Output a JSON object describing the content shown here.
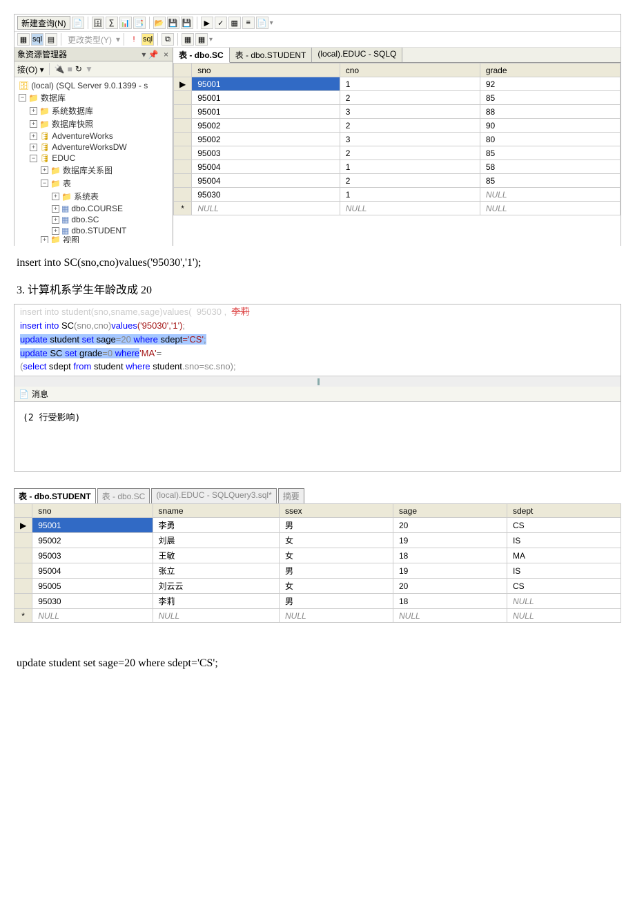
{
  "toolbar": {
    "newQuery": "新建查询(N)",
    "changeType": "更改类型(Y)"
  },
  "objectExplorer": {
    "title": "象资源管理器",
    "connectLabel": "接(O)",
    "server": "(local) (SQL Server 9.0.1399 - s",
    "nodes": {
      "databases": "数据库",
      "sysdb": "系统数据库",
      "snapshot": "数据库快照",
      "adv": "AdventureWorks",
      "advdw": "AdventureWorksDW",
      "educ": "EDUC",
      "dbdiagram": "数据库关系图",
      "tables": "表",
      "systables": "系统表",
      "course": "dbo.COURSE",
      "sc": "dbo.SC",
      "student": "dbo.STUDENT",
      "views": "视图"
    }
  },
  "clickTabs": [
    "表 - dbo.SC",
    "表 - dbo.STUDENT",
    "(local).EDUC - SQLQ"
  ],
  "scGrid": {
    "headers": [
      "sno",
      "cno",
      "grade"
    ],
    "rows": [
      [
        "95001",
        "1",
        "92"
      ],
      [
        "95001",
        "2",
        "85"
      ],
      [
        "95001",
        "3",
        "88"
      ],
      [
        "95002",
        "2",
        "90"
      ],
      [
        "95002",
        "3",
        "80"
      ],
      [
        "95003",
        "2",
        "85"
      ],
      [
        "95004",
        "1",
        "58"
      ],
      [
        "95004",
        "2",
        "85"
      ],
      [
        "95030",
        "1",
        "NULL"
      ],
      [
        "NULL",
        "NULL",
        "NULL"
      ]
    ]
  },
  "docText1": "insert into SC(sno,cno)values('95030','1');",
  "docText2": "3. 计算机系学生年龄改成 20",
  "sqlLines": {
    "l1a": "insert into student(",
    "l1b": "sno,sname,sage",
    "l1c": ")values(  95030 ,  ",
    "l1d": "李莉",
    "l2a": "insert into",
    "l2b": " SC",
    "l2c": "(sno,cno)",
    "l2d": "values",
    "l2e": "('95030','1')",
    "l2f": ";",
    "l3a": "update",
    "l3b": " student ",
    "l3c": "set",
    "l3d": " sage",
    "l3e": "=20 ",
    "l3f": "where",
    "l3g": " sdept",
    "l3h": "='CS'",
    "l3i": ";",
    "l4a": "update",
    "l4b": " SC ",
    "l4c": "set",
    "l4d": " grade",
    "l4e": "=0 ",
    "l4f": "where",
    "l4g": "'MA'",
    "l4h": "=",
    "l5a": "(",
    "l5b": "select",
    "l5c": " sdept ",
    "l5d": "from",
    "l5e": " student ",
    "l5f": "where",
    "l5g": " student",
    "l5h": ".sno=sc.sno);"
  },
  "messages": {
    "tabLabel": "消息",
    "content": "(2 行受影响)"
  },
  "bottomTabs": [
    "表 - dbo.STUDENT",
    "表 - dbo.SC",
    "(local).EDUC - SQLQuery3.sql*",
    "摘要"
  ],
  "studentGrid": {
    "headers": [
      "sno",
      "sname",
      "ssex",
      "sage",
      "sdept"
    ],
    "rows": [
      [
        "95001",
        "李勇",
        "男",
        "20",
        "CS"
      ],
      [
        "95002",
        "刘晨",
        "女",
        "19",
        "IS"
      ],
      [
        "95003",
        "王敏",
        "女",
        "18",
        "MA"
      ],
      [
        "95004",
        "张立",
        "男",
        "19",
        "IS"
      ],
      [
        "95005",
        "刘云云",
        "女",
        "20",
        "CS"
      ],
      [
        "95030",
        "李莉",
        "男",
        "18",
        "NULL"
      ],
      [
        "NULL",
        "NULL",
        "NULL",
        "NULL",
        "NULL"
      ]
    ]
  },
  "docText3": "update student set sage=20 where sdept='CS';"
}
